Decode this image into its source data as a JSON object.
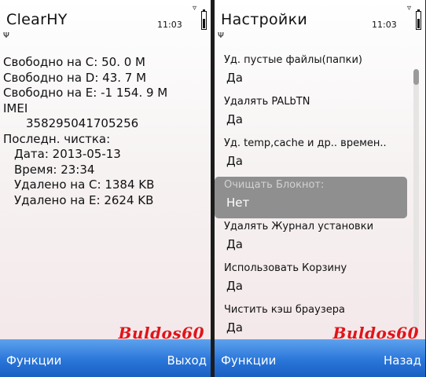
{
  "left": {
    "title": "ClearHY",
    "time": "11:03",
    "lines": [
      "Свободно на C: 50. 0 М",
      "Свободно на D: 43. 7 М",
      "Свободно на E: -1 154. 9 М",
      "IMEI",
      "358295041705256",
      "Последн. чистка:",
      "Дата: 2013-05-13",
      "Время: 23:34",
      "Удалено на C: 1384 KB",
      "Удалено на E: 2624 KB"
    ],
    "soft_left": "Функции",
    "soft_right": "Выход"
  },
  "right": {
    "title": "Настройки",
    "time": "11:03",
    "items": [
      {
        "label": "Уд. пустые файлы(папки)",
        "value": "Да"
      },
      {
        "label": "Удалять  PALbTN",
        "value": "Да"
      },
      {
        "label": "Уд. temp,cache и др.. времен..",
        "value": "Да"
      },
      {
        "label": "Очищать Блокнот:",
        "value": "Нет"
      },
      {
        "label": "Удалять Журнал установки",
        "value": "Да"
      },
      {
        "label": "Использовать Корзину",
        "value": "Да"
      },
      {
        "label": "Чистить кэш браузера",
        "value": "Да"
      }
    ],
    "soft_left": "Функции",
    "soft_right": "Назад"
  },
  "watermark": "Buldos60",
  "icons": {
    "signal": "antenna-icon",
    "battery": "battery-icon",
    "network": "network-indicator-icon"
  },
  "colors": {
    "softbar": "#2a76d9",
    "selected_item": "#8f8f8f",
    "watermark": "#e0141a"
  }
}
